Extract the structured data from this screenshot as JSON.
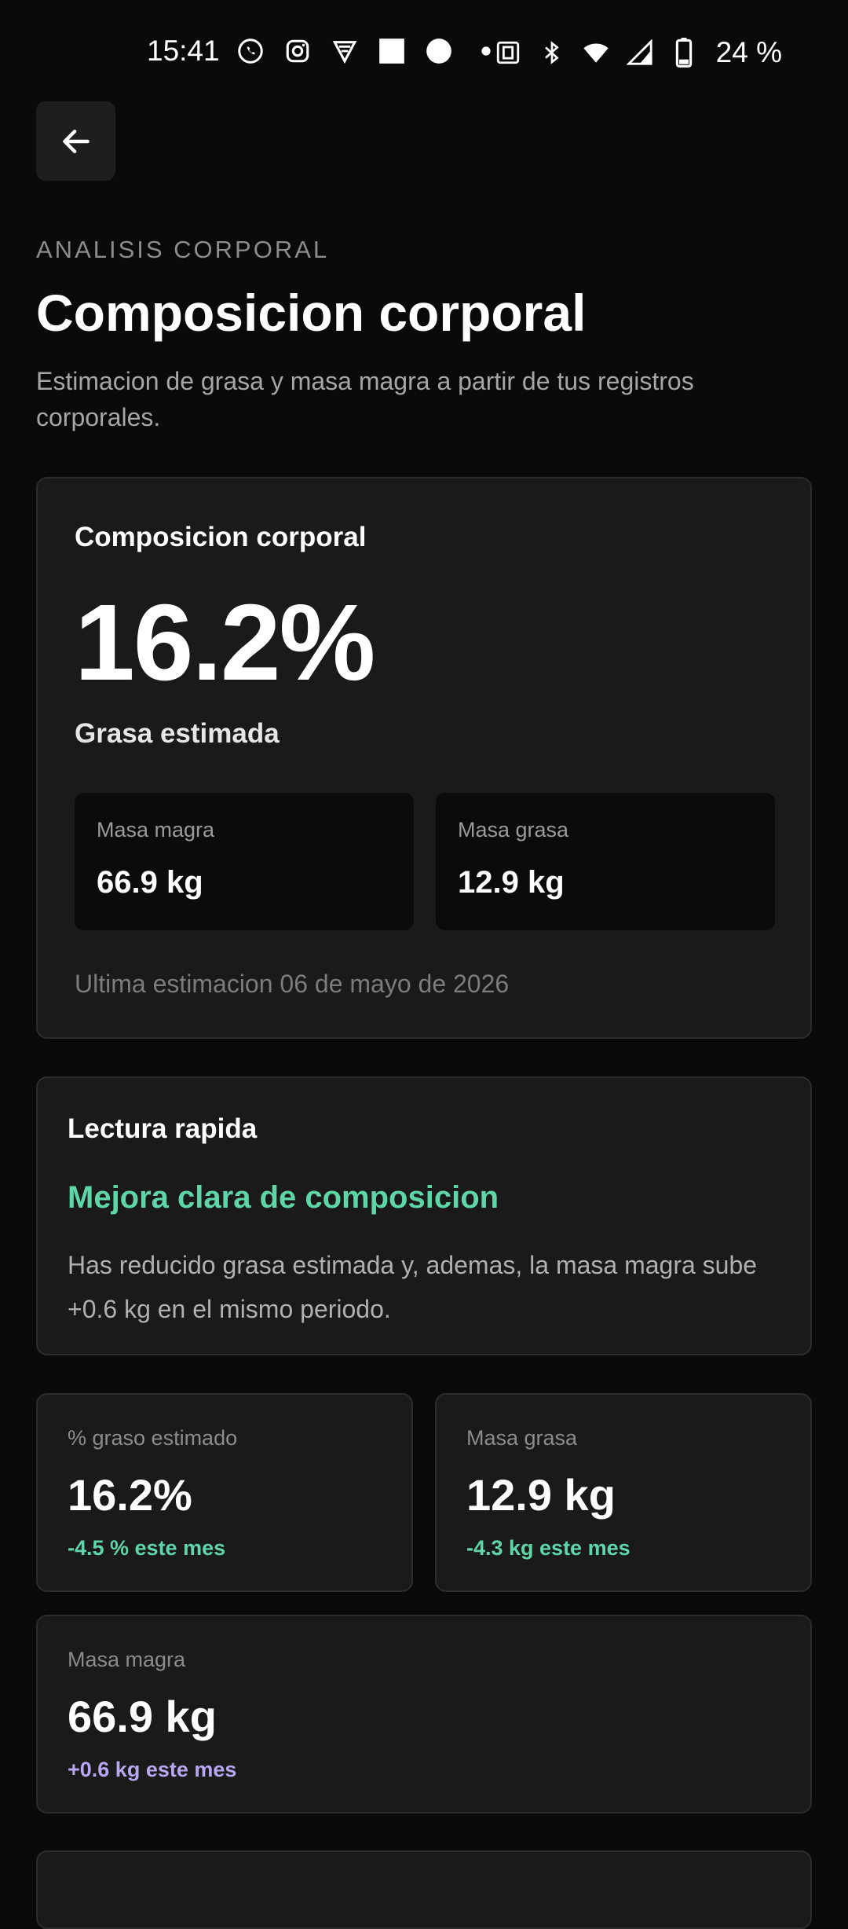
{
  "status_bar": {
    "time": "15:41",
    "battery": "24 %",
    "left_icons": [
      "whatsapp-icon",
      "instagram-icon",
      "shield-app-icon",
      "square-icon",
      "circle-icon",
      "dot-icon"
    ],
    "right_icons": [
      "nfc-icon",
      "bluetooth-icon",
      "wifi-icon",
      "signal-icon",
      "battery-icon"
    ]
  },
  "header": {
    "back_icon": "arrow-left-icon",
    "eyebrow": "ANALISIS CORPORAL",
    "title": "Composicion corporal",
    "description": "Estimacion de grasa y masa magra a partir de tus registros corporales."
  },
  "main_card": {
    "title": "Composicion corporal",
    "big_value": "16.2%",
    "big_label": "Grasa estimada",
    "lean_label": "Masa magra",
    "lean_value": "66.9 kg",
    "fat_label": "Masa grasa",
    "fat_value": "12.9 kg",
    "footer": "Ultima estimacion 06 de mayo de 2026"
  },
  "quick_read": {
    "title": "Lectura rapida",
    "headline": "Mejora clara de composicion",
    "body": "Has reducido grasa estimada y, ademas, la masa magra sube +0.6 kg en el mismo periodo."
  },
  "stats": [
    {
      "label": "% graso estimado",
      "value": "16.2%",
      "delta": "-4.5 % este mes"
    },
    {
      "label": "Masa grasa",
      "value": "12.9 kg",
      "delta": "-4.3 kg este mes"
    },
    {
      "label": "Masa magra",
      "value": "66.9 kg",
      "delta": "+0.6 kg este mes"
    }
  ],
  "colors": {
    "background": "#0a0a0a",
    "card": "#1a1a1a",
    "accent_green": "#5fd6a8",
    "accent_purple": "#b9a6f0"
  }
}
